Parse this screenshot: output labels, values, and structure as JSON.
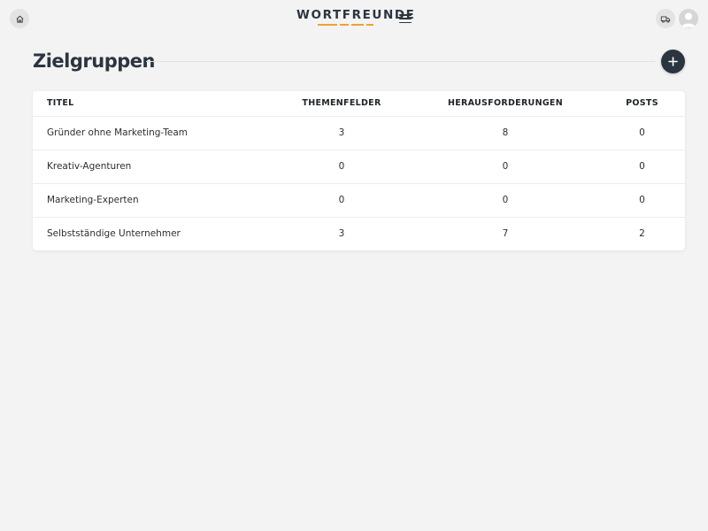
{
  "header": {
    "brand": "WORTFREUNDE",
    "icons": {
      "home": "home-icon",
      "menu": "hamburger-menu-icon",
      "truck": "truck-icon",
      "avatar": "user-avatar-icon",
      "add": "plus-icon"
    },
    "colors": {
      "brand_dark": "#2b3540",
      "accent": "#f0a030"
    }
  },
  "page": {
    "title": "Zielgruppen"
  },
  "table": {
    "columns": [
      "TITEL",
      "THEMENFELDER",
      "HERAUSFORDERUNGEN",
      "POSTS"
    ],
    "rows": [
      {
        "titel": "Gründer ohne Marketing-Team",
        "themenfelder": "3",
        "herausforderungen": "8",
        "posts": "0"
      },
      {
        "titel": "Kreativ-Agenturen",
        "themenfelder": "0",
        "herausforderungen": "0",
        "posts": "0"
      },
      {
        "titel": "Marketing-Experten",
        "themenfelder": "0",
        "herausforderungen": "0",
        "posts": "0"
      },
      {
        "titel": "Selbstständige Unternehmer",
        "themenfelder": "3",
        "herausforderungen": "7",
        "posts": "2"
      }
    ]
  }
}
